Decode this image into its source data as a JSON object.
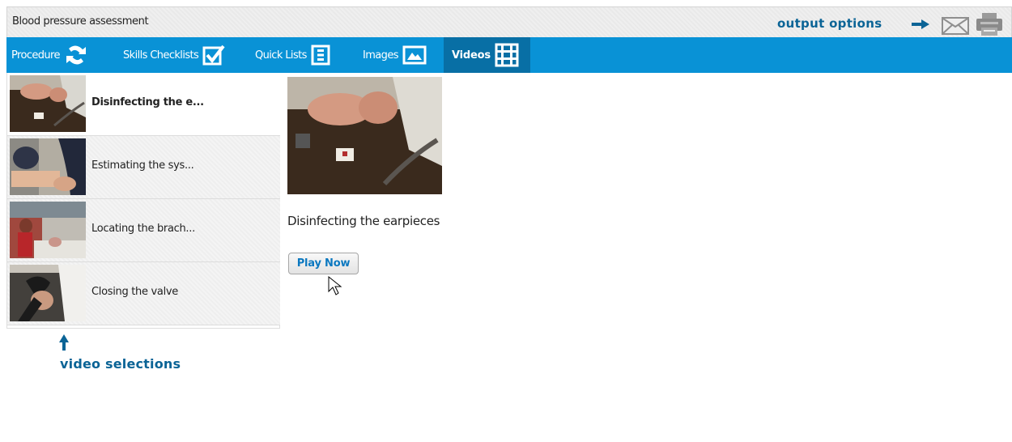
{
  "window": {
    "title": "Blood pressure assessment"
  },
  "output_options": {
    "label": "output options",
    "email_icon": "envelope-icon",
    "print_icon": "printer-icon"
  },
  "tabs": [
    {
      "label": "Procedure",
      "icon": "procedure-swirl-icon",
      "active": false
    },
    {
      "label": "Skills Checklists",
      "icon": "checkbox-icon",
      "active": false
    },
    {
      "label": "Quick Lists",
      "icon": "list-icon",
      "active": false
    },
    {
      "label": "Images",
      "icon": "image-icon",
      "active": false
    },
    {
      "label": "Videos",
      "icon": "film-strip-icon",
      "active": true
    }
  ],
  "videos": [
    {
      "label": "Disinfecting the e...",
      "selected": true
    },
    {
      "label": "Estimating the sys...",
      "selected": false
    },
    {
      "label": "Locating the brach...",
      "selected": false
    },
    {
      "label": "Closing the valve",
      "selected": false
    }
  ],
  "main": {
    "video_title": "Disinfecting the earpieces",
    "play_button_label": "Play Now"
  },
  "annotations": {
    "video_selections": "video selections"
  },
  "colors": {
    "nav_blue": "#0992d6",
    "active_tab": "#086fa5",
    "annotation_blue": "#0b6496",
    "play_text": "#0b78c0"
  }
}
